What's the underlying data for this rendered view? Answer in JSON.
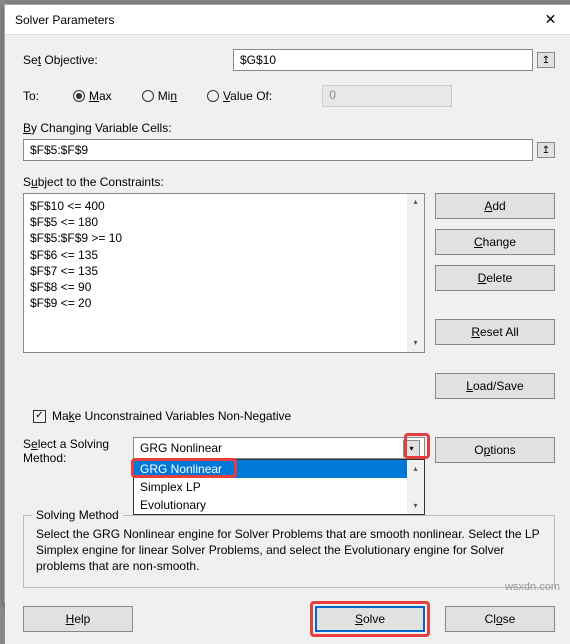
{
  "title": "Solver Parameters",
  "objective": {
    "label": "Set Objective:",
    "value": "$G$10"
  },
  "to": {
    "label": "To:",
    "max": "Max",
    "min": "Min",
    "valueof": "Value Of:",
    "valueof_input": "0",
    "selected": "max"
  },
  "changing": {
    "label": "By Changing Variable Cells:",
    "value": "$F$5:$F$9"
  },
  "constraints": {
    "label": "Subject to the Constraints:",
    "items": [
      "$F$10 <= 400",
      "$F$5 <= 180",
      "$F$5:$F$9 >= 10",
      "$F$6 <= 135",
      "$F$7 <= 135",
      "$F$8 <= 90",
      "$F$9 <= 20"
    ]
  },
  "buttons": {
    "add": "Add",
    "change": "Change",
    "delete": "Delete",
    "resetall": "Reset All",
    "loadsave": "Load/Save",
    "options": "Options",
    "help": "Help",
    "solve": "Solve",
    "close": "Close"
  },
  "nonneg": {
    "checked": true,
    "label": "Make Unconstrained Variables Non-Negative"
  },
  "method": {
    "label": "Select a Solving Method:",
    "selected": "GRG Nonlinear",
    "options": [
      "GRG Nonlinear",
      "Simplex LP",
      "Evolutionary"
    ],
    "highlighted": "GRG Nonlinear"
  },
  "groupbox": {
    "title": "Solving Method",
    "text": "Select the GRG Nonlinear engine for Solver Problems that are smooth nonlinear. Select the LP Simplex engine for linear Solver Problems, and select the Evolutionary engine for Solver problems that are non-smooth."
  },
  "watermark": "wsxdn.com"
}
